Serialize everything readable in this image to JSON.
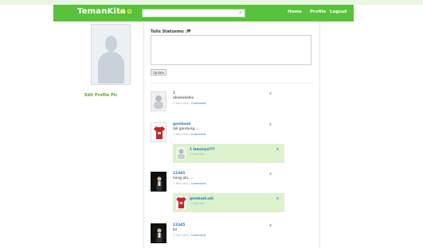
{
  "header": {
    "logo": "TemanKita",
    "logo_icons": "✿ ✿",
    "search_placeholder": "",
    "nav": [
      "Home",
      "Profile",
      "Logout"
    ]
  },
  "sidebar": {
    "edit_profile": "Edit Profile Pic"
  },
  "status": {
    "label": "Tulis Statusmu ..!",
    "camera_icon": "camera-icon",
    "update_button": "Update"
  },
  "posts": [
    {
      "author": "1",
      "text": "abiokokobiu",
      "time": "1 hari lalu",
      "comment": "Comment",
      "close": "x"
    },
    {
      "author": "gombask",
      "text": "lali gandung.....",
      "time": "1 hari lalu",
      "comment": "Comment",
      "close": "x",
      "reply": {
        "author": "1 lamanya???",
        "time": "1 hari lalu",
        "close": "x"
      }
    },
    {
      "author": "12345",
      "text": "hang jali.....",
      "time": "1 hari lalu",
      "comment": "Comment",
      "close": "x",
      "reply": {
        "author": "gombask:aik",
        "time": "1 hari lalu",
        "close": "x"
      }
    },
    {
      "author": "12345",
      "text": "lol",
      "time": "1 hari lalu",
      "comment": "Comment",
      "close": "x"
    }
  ],
  "colors": {
    "brand": "#58c23a",
    "link": "#2d74b8",
    "reply_bg": "#dbf2cc"
  }
}
